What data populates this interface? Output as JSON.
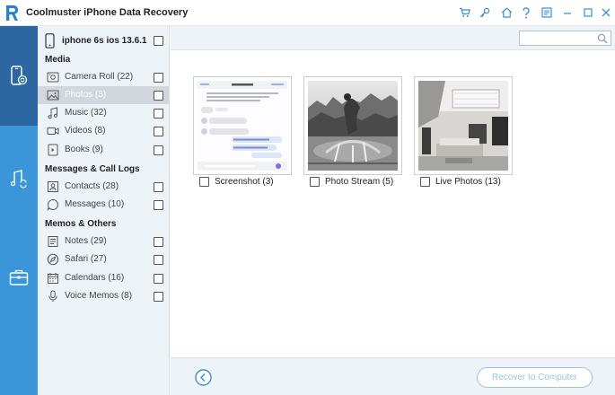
{
  "app": {
    "title": "Coolmuster iPhone Data Recovery"
  },
  "colors": {
    "accent": "#3a96d8",
    "rail_active": "#2c67a1",
    "panel_bg": "#eef3f8",
    "selected_bg": "#d2d7dd",
    "button_text": "#9cc4e6"
  },
  "titlebar_icons": [
    "cart-icon",
    "key-icon",
    "home-icon",
    "help-icon",
    "feedback-icon",
    "minimize-icon",
    "maximize-icon",
    "close-icon"
  ],
  "device": {
    "name": "iphone 6s ios 13.6.1"
  },
  "sections": [
    {
      "title": "Media",
      "items": [
        {
          "label": "Camera Roll",
          "count": "(22)",
          "icon": "camera-icon"
        },
        {
          "label": "Photos",
          "count": "(3)",
          "icon": "photos-icon",
          "selected": true
        },
        {
          "label": "Music",
          "count": "(32)",
          "icon": "music-icon"
        },
        {
          "label": "Videos",
          "count": "(8)",
          "icon": "video-icon"
        },
        {
          "label": "Books",
          "count": "(9)",
          "icon": "book-icon"
        }
      ]
    },
    {
      "title": "Messages & Call Logs",
      "items": [
        {
          "label": "Contacts",
          "count": "(28)",
          "icon": "contacts-icon"
        },
        {
          "label": "Messages",
          "count": "(10)",
          "icon": "messages-icon"
        }
      ]
    },
    {
      "title": "Memos & Others",
      "items": [
        {
          "label": "Notes",
          "count": "(29)",
          "icon": "notes-icon"
        },
        {
          "label": "Safari",
          "count": "(27)",
          "icon": "safari-icon"
        },
        {
          "label": "Calendars",
          "count": "(16)",
          "icon": "calendar-icon"
        },
        {
          "label": "Voice Memos",
          "count": "(8)",
          "icon": "microphone-icon"
        }
      ]
    }
  ],
  "albums": [
    {
      "name": "Screenshot (3)"
    },
    {
      "name": "Photo Stream (5)"
    },
    {
      "name": "Live Photos (13)"
    }
  ],
  "search": {
    "placeholder": ""
  },
  "footer": {
    "recover_label": "Recover to Computer"
  }
}
